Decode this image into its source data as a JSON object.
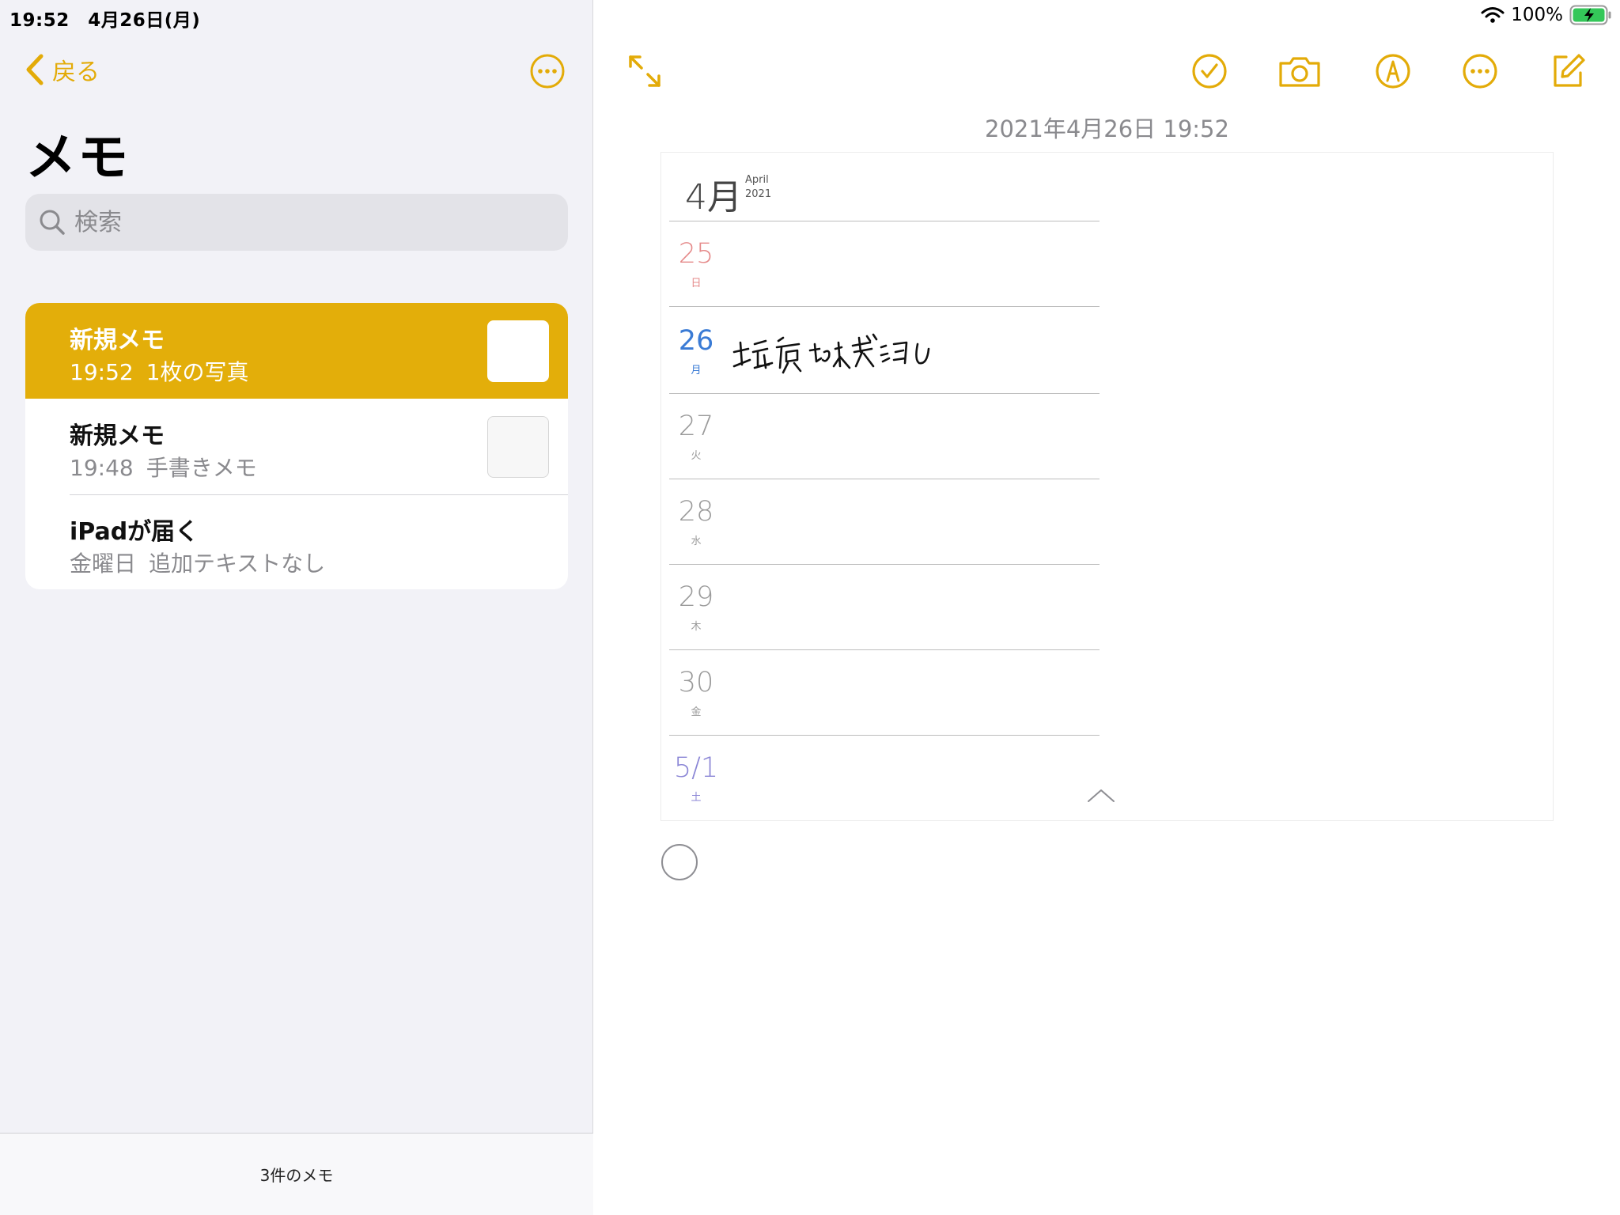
{
  "status": {
    "time_date": "19:52　4月26日(月)",
    "battery": "100%"
  },
  "sidebar": {
    "back_label": "戻る",
    "title": "メモ",
    "search_placeholder": "検索",
    "notes": [
      {
        "title": "新規メモ",
        "date": "19:52",
        "preview": "1枚の写真",
        "selected": true
      },
      {
        "title": "新規メモ",
        "date": "19:48",
        "preview": "手書きメモ",
        "selected": false
      },
      {
        "title": "iPadが届く",
        "date": "金曜日",
        "preview": "追加テキストなし",
        "selected": false
      }
    ],
    "footer": "3件のメモ"
  },
  "editor": {
    "date": "2021年4月26日 19:52",
    "calendar": {
      "month": "4月",
      "month_en": "April",
      "year": "2021",
      "days": [
        {
          "day": "25",
          "weekday": "日",
          "color": "#e58a8a"
        },
        {
          "day": "26",
          "weekday": "月",
          "color": "#3a7bd5",
          "note": "塩原さん来訪"
        },
        {
          "day": "27",
          "weekday": "火",
          "color": "#9a9a9a"
        },
        {
          "day": "28",
          "weekday": "水",
          "color": "#9a9a9a"
        },
        {
          "day": "29",
          "weekday": "木",
          "color": "#9a9a9a"
        },
        {
          "day": "30",
          "weekday": "金",
          "color": "#9a9a9a"
        },
        {
          "day": "5/1",
          "weekday": "土",
          "color": "#8b86d6"
        }
      ]
    }
  },
  "colors": {
    "accent": "#e3ab08",
    "selected_row": "#e3ae0a"
  }
}
